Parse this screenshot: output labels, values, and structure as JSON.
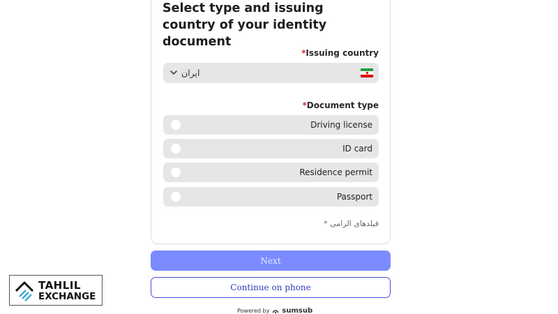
{
  "form": {
    "title": "Select type and issuing country of your identity document",
    "country": {
      "label": "Issuing country",
      "required_mark": "*",
      "value": "ایران",
      "flag_icon": "iran-flag-icon"
    },
    "document_type": {
      "label": "Document type",
      "required_mark": "*",
      "options": [
        {
          "label": "Driving license",
          "selected": false
        },
        {
          "label": "ID card",
          "selected": false
        },
        {
          "label": "Residence permit",
          "selected": false
        },
        {
          "label": "Passport",
          "selected": false
        }
      ]
    },
    "required_note": "* فیلدهای الزامی"
  },
  "actions": {
    "next_label": "Next",
    "phone_label": "Continue on phone"
  },
  "footer": {
    "powered_by": "Powered by",
    "brand": "sumsub"
  },
  "watermark": {
    "line1": "TAHLIL",
    "line2": "EXCHANGE"
  },
  "colors": {
    "primary": "#7b8bff",
    "outline": "#4352d6",
    "field_bg": "#e6e6e6",
    "required": "#d32f2f"
  }
}
